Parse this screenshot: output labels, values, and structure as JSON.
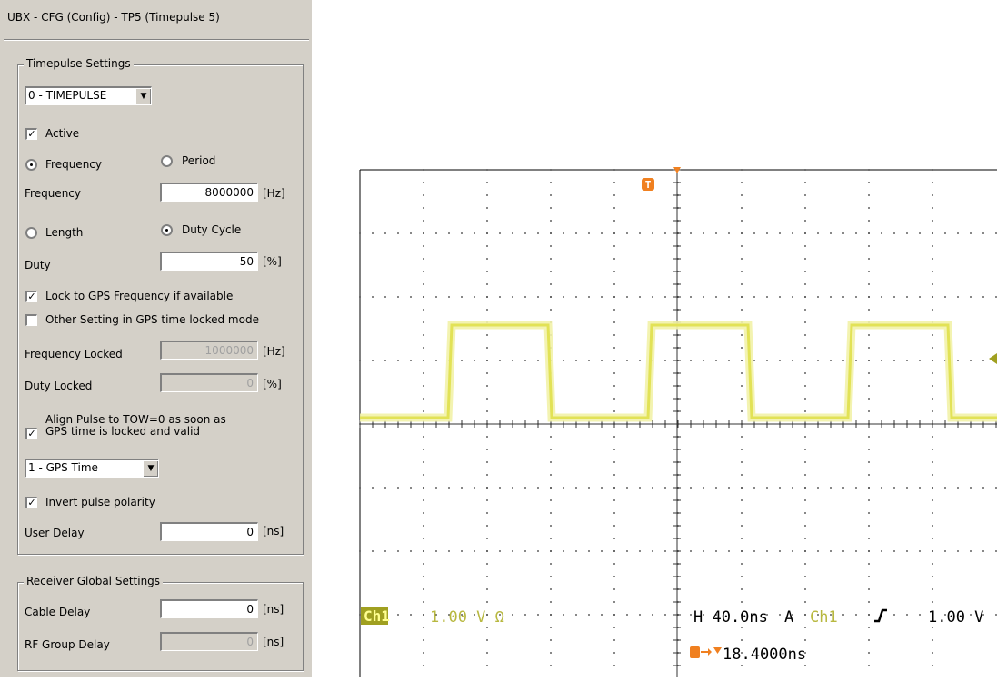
{
  "window": {
    "title": "UBX - CFG (Config) - TP5 (Timepulse 5)"
  },
  "timepulse": {
    "group_label": "Timepulse Settings",
    "select_value": "0 - TIMEPULSE",
    "active": {
      "label": "Active",
      "checked": true
    },
    "mode_frequency": {
      "label": "Frequency",
      "selected": true
    },
    "mode_period": {
      "label": "Period",
      "selected": false
    },
    "frequency": {
      "label": "Frequency",
      "value": "8000000",
      "unit": "[Hz]"
    },
    "mode_length": {
      "label": "Length",
      "selected": false
    },
    "mode_duty": {
      "label": "Duty Cycle",
      "selected": true
    },
    "duty": {
      "label": "Duty",
      "value": "50",
      "unit": "[%]"
    },
    "lock_gps": {
      "label": "Lock to GPS Frequency if available",
      "checked": true
    },
    "other_setting": {
      "label": "Other Setting in GPS time locked mode",
      "checked": false
    },
    "freq_locked": {
      "label": "Frequency Locked",
      "value": "1000000",
      "unit": "[Hz]"
    },
    "duty_locked": {
      "label": "Duty Locked",
      "value": "0",
      "unit": "[%]"
    },
    "align_pulse": {
      "label_line1": "Align Pulse to TOW=0 as soon as",
      "label_line2": "GPS time is locked and valid",
      "checked": true
    },
    "time_source": "1 - GPS Time",
    "invert": {
      "label": "Invert pulse polarity",
      "checked": true
    },
    "user_delay": {
      "label": "User Delay",
      "value": "0",
      "unit": "[ns]"
    }
  },
  "receiver": {
    "group_label": "Receiver Global Settings",
    "cable_delay": {
      "label": "Cable Delay",
      "value": "0",
      "unit": "[ns]"
    },
    "rf_group_delay": {
      "label": "RF Group Delay",
      "value": "0",
      "unit": "[ns]"
    }
  },
  "scope": {
    "trigger_marker": "T",
    "ch_badge": "Ch1",
    "ch_scale": "1.00 V Ω",
    "timebase": "H 40.0ns",
    "trig_mode": "A",
    "trig_ch": "Ch1",
    "trig_slope": "⌠",
    "trig_level": "1.00 V",
    "trig_offset": "18.4000ns",
    "colors": {
      "trace": "#e6e65a",
      "trigger": "#f08020",
      "badge": "#a0a020"
    }
  }
}
